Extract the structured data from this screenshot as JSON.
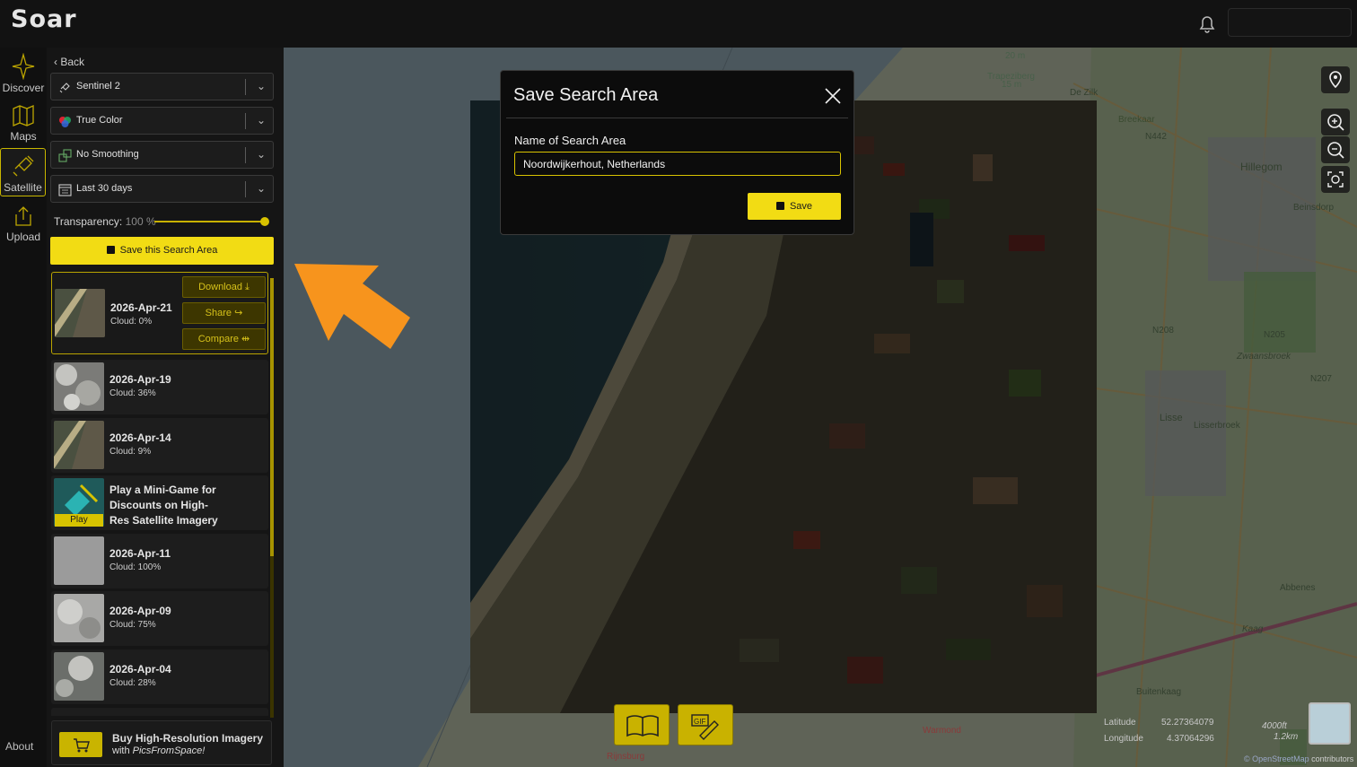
{
  "header": {
    "logo": "Soar"
  },
  "nav": {
    "items": [
      {
        "label": "Discover",
        "icon": "compass-icon"
      },
      {
        "label": "Maps",
        "icon": "map-icon"
      },
      {
        "label": "Satellite",
        "icon": "satellite-icon",
        "active": true
      },
      {
        "label": "Upload",
        "icon": "upload-icon"
      }
    ],
    "about": "About"
  },
  "sidebar": {
    "back": "Back",
    "selects": [
      {
        "value": "Sentinel 2",
        "icon": "satellite-icon"
      },
      {
        "value": "True Color",
        "icon": "color-circles-icon"
      },
      {
        "value": "No Smoothing",
        "icon": "grid-icon"
      },
      {
        "value": "Last 30 days",
        "icon": "calendar-icon"
      }
    ],
    "transparency_label": "Transparency:",
    "transparency_value": "100 %",
    "transparency_level": 1.0,
    "save_area_button": "Save this Search Area",
    "results": [
      {
        "date": "2026-Apr-21",
        "cloud": "Cloud: 0%",
        "selected": true
      },
      {
        "date": "2026-Apr-19",
        "cloud": "Cloud: 36%"
      },
      {
        "date": "2026-Apr-14",
        "cloud": "Cloud: 9%"
      },
      {
        "date": "2026-Apr-11",
        "cloud": "Cloud: 100%"
      },
      {
        "date": "2026-Apr-09",
        "cloud": "Cloud: 75%"
      },
      {
        "date": "2026-Apr-04",
        "cloud": "Cloud: 28%"
      }
    ],
    "actions": {
      "download": "Download",
      "share": "Share",
      "compare": "Compare"
    },
    "promo": {
      "text": "Play a Mini-Game for Discounts on High-Res Satellite Imagery",
      "badge": "Play"
    },
    "buy": {
      "title": "Buy High-Resolution Imagery",
      "with": "with ",
      "brand": "PicsFromSpace!"
    }
  },
  "map": {
    "labels": [
      "Trapeziberg",
      "20 m",
      "15 m",
      "Breekaar",
      "De Zilk",
      "N442",
      "Hillegom",
      "Beinsdorp",
      "N208",
      "N205",
      "Zwaansbroek",
      "N207",
      "Lisse",
      "Lisserbroek",
      "Abbenes",
      "Kaag",
      "Buitenkaag",
      "Warmond",
      "Rijnsburg"
    ],
    "latitude_label": "Latitude",
    "latitude_value": "52.27364079",
    "longitude_label": "Longitude",
    "longitude_value": "4.37064296",
    "scale_top": "4000ft",
    "scale_bottom": "1.2km",
    "attribution_link": "© OpenStreetMap",
    "attribution_rest": " contributors",
    "controls": [
      "location-pin-icon",
      "zoom-in-icon",
      "zoom-out-icon",
      "zoom-fit-icon"
    ],
    "bottom_buttons": [
      "book-icon",
      "gif-edit-icon"
    ]
  },
  "dialog": {
    "title": "Save Search Area",
    "label": "Name of Search Area",
    "input_value": "Noordwijkerhout, Netherlands",
    "save": "Save"
  },
  "colors": {
    "accent": "#f2dc14",
    "panel": "#151515",
    "sea": "#aac7d4",
    "arrow": "#f7941d"
  }
}
